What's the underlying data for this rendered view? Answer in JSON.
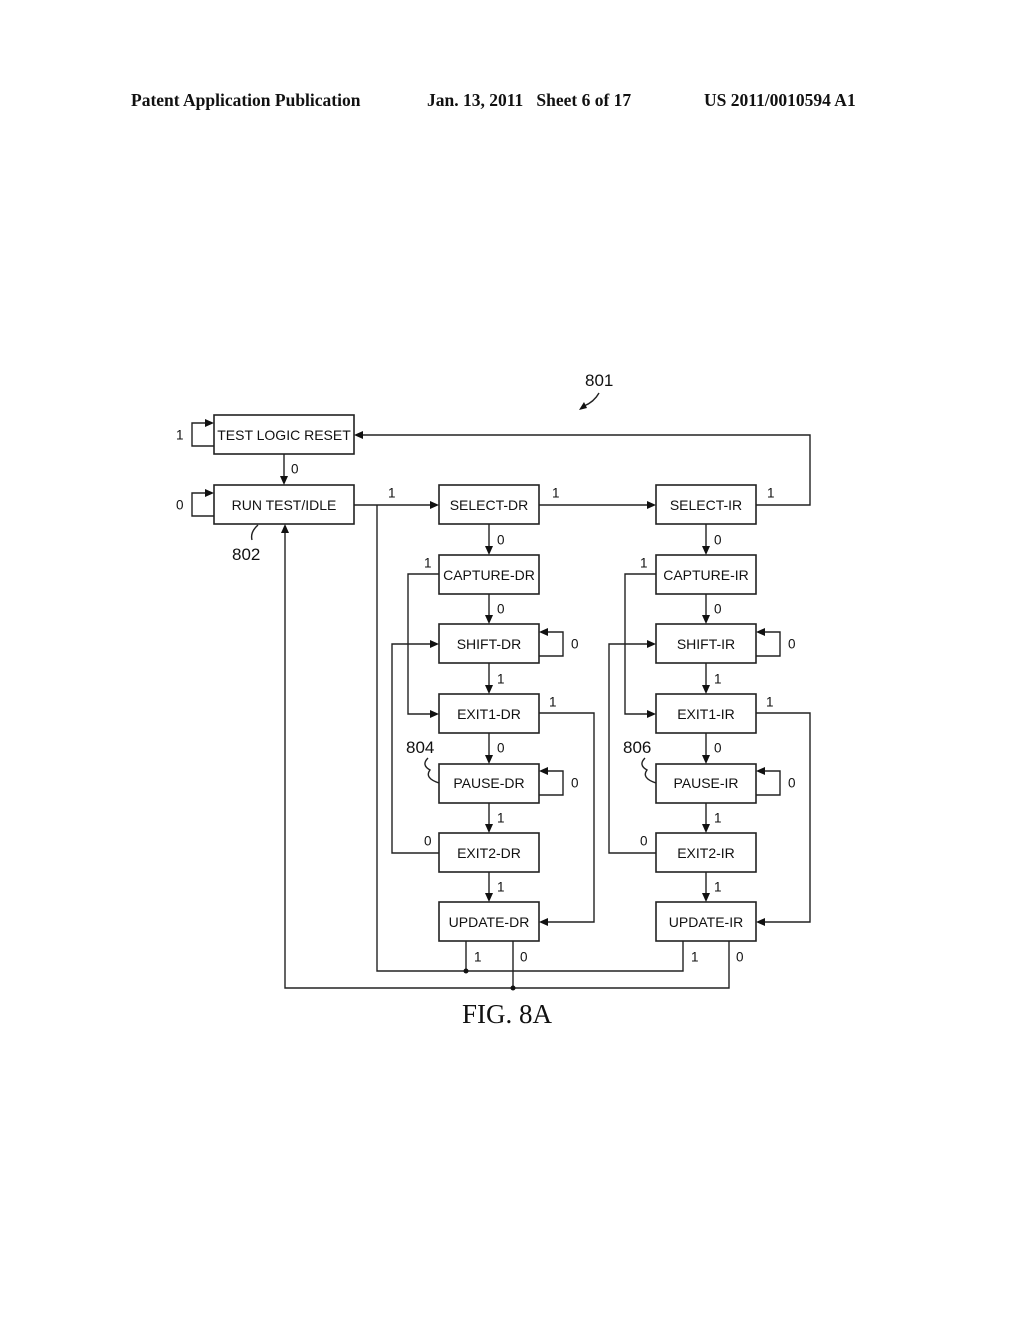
{
  "header": {
    "publication": "Patent Application Publication",
    "date_sheet": "Jan. 13, 2011   Sheet 6 of 17",
    "pub_number": "US 2011/0010594 A1"
  },
  "figure": {
    "caption": "FIG. 8A",
    "reference_numerals": {
      "diagram": "801",
      "run_test_idle": "802",
      "pause_dr": "804",
      "pause_ir": "806"
    },
    "states": {
      "test_logic_reset": "TEST LOGIC RESET",
      "run_test_idle": "RUN TEST/IDLE",
      "select_dr": "SELECT-DR",
      "capture_dr": "CAPTURE-DR",
      "shift_dr": "SHIFT-DR",
      "exit1_dr": "EXIT1-DR",
      "pause_dr": "PAUSE-DR",
      "exit2_dr": "EXIT2-DR",
      "update_dr": "UPDATE-DR",
      "select_ir": "SELECT-IR",
      "capture_ir": "CAPTURE-IR",
      "shift_ir": "SHIFT-IR",
      "exit1_ir": "EXIT1-IR",
      "pause_ir": "PAUSE-IR",
      "exit2_ir": "EXIT2-IR",
      "update_ir": "UPDATE-IR"
    },
    "transitions": [
      {
        "from": "TEST LOGIC RESET",
        "to": "TEST LOGIC RESET",
        "label": "1"
      },
      {
        "from": "TEST LOGIC RESET",
        "to": "RUN TEST/IDLE",
        "label": "0"
      },
      {
        "from": "RUN TEST/IDLE",
        "to": "RUN TEST/IDLE",
        "label": "0"
      },
      {
        "from": "RUN TEST/IDLE",
        "to": "SELECT-DR",
        "label": "1"
      },
      {
        "from": "SELECT-DR",
        "to": "SELECT-IR",
        "label": "1"
      },
      {
        "from": "SELECT-DR",
        "to": "CAPTURE-DR",
        "label": "0"
      },
      {
        "from": "SELECT-IR",
        "to": "TEST LOGIC RESET",
        "label": "1"
      },
      {
        "from": "SELECT-IR",
        "to": "CAPTURE-IR",
        "label": "0"
      },
      {
        "from": "CAPTURE-DR",
        "to": "SHIFT-DR",
        "label": "0"
      },
      {
        "from": "CAPTURE-DR",
        "to": "EXIT1-DR",
        "label": "1"
      },
      {
        "from": "SHIFT-DR",
        "to": "SHIFT-DR",
        "label": "0"
      },
      {
        "from": "SHIFT-DR",
        "to": "EXIT1-DR",
        "label": "1"
      },
      {
        "from": "EXIT1-DR",
        "to": "PAUSE-DR",
        "label": "0"
      },
      {
        "from": "EXIT1-DR",
        "to": "UPDATE-DR",
        "label": "1"
      },
      {
        "from": "PAUSE-DR",
        "to": "PAUSE-DR",
        "label": "0"
      },
      {
        "from": "PAUSE-DR",
        "to": "EXIT2-DR",
        "label": "1"
      },
      {
        "from": "EXIT2-DR",
        "to": "SHIFT-DR",
        "label": "0"
      },
      {
        "from": "EXIT2-DR",
        "to": "UPDATE-DR",
        "label": "1"
      },
      {
        "from": "UPDATE-DR",
        "to": "SELECT-DR",
        "label": "1"
      },
      {
        "from": "UPDATE-DR",
        "to": "RUN TEST/IDLE",
        "label": "0"
      },
      {
        "from": "CAPTURE-IR",
        "to": "SHIFT-IR",
        "label": "0"
      },
      {
        "from": "CAPTURE-IR",
        "to": "EXIT1-IR",
        "label": "1"
      },
      {
        "from": "SHIFT-IR",
        "to": "SHIFT-IR",
        "label": "0"
      },
      {
        "from": "SHIFT-IR",
        "to": "EXIT1-IR",
        "label": "1"
      },
      {
        "from": "EXIT1-IR",
        "to": "PAUSE-IR",
        "label": "0"
      },
      {
        "from": "EXIT1-IR",
        "to": "UPDATE-IR",
        "label": "1"
      },
      {
        "from": "PAUSE-IR",
        "to": "PAUSE-IR",
        "label": "0"
      },
      {
        "from": "PAUSE-IR",
        "to": "EXIT2-IR",
        "label": "1"
      },
      {
        "from": "EXIT2-IR",
        "to": "SHIFT-IR",
        "label": "0"
      },
      {
        "from": "EXIT2-IR",
        "to": "UPDATE-IR",
        "label": "1"
      },
      {
        "from": "UPDATE-IR",
        "to": "SELECT-DR",
        "label": "1"
      },
      {
        "from": "UPDATE-IR",
        "to": "RUN TEST/IDLE",
        "label": "0"
      }
    ],
    "bit_labels": {
      "zero": "0",
      "one": "1"
    }
  }
}
